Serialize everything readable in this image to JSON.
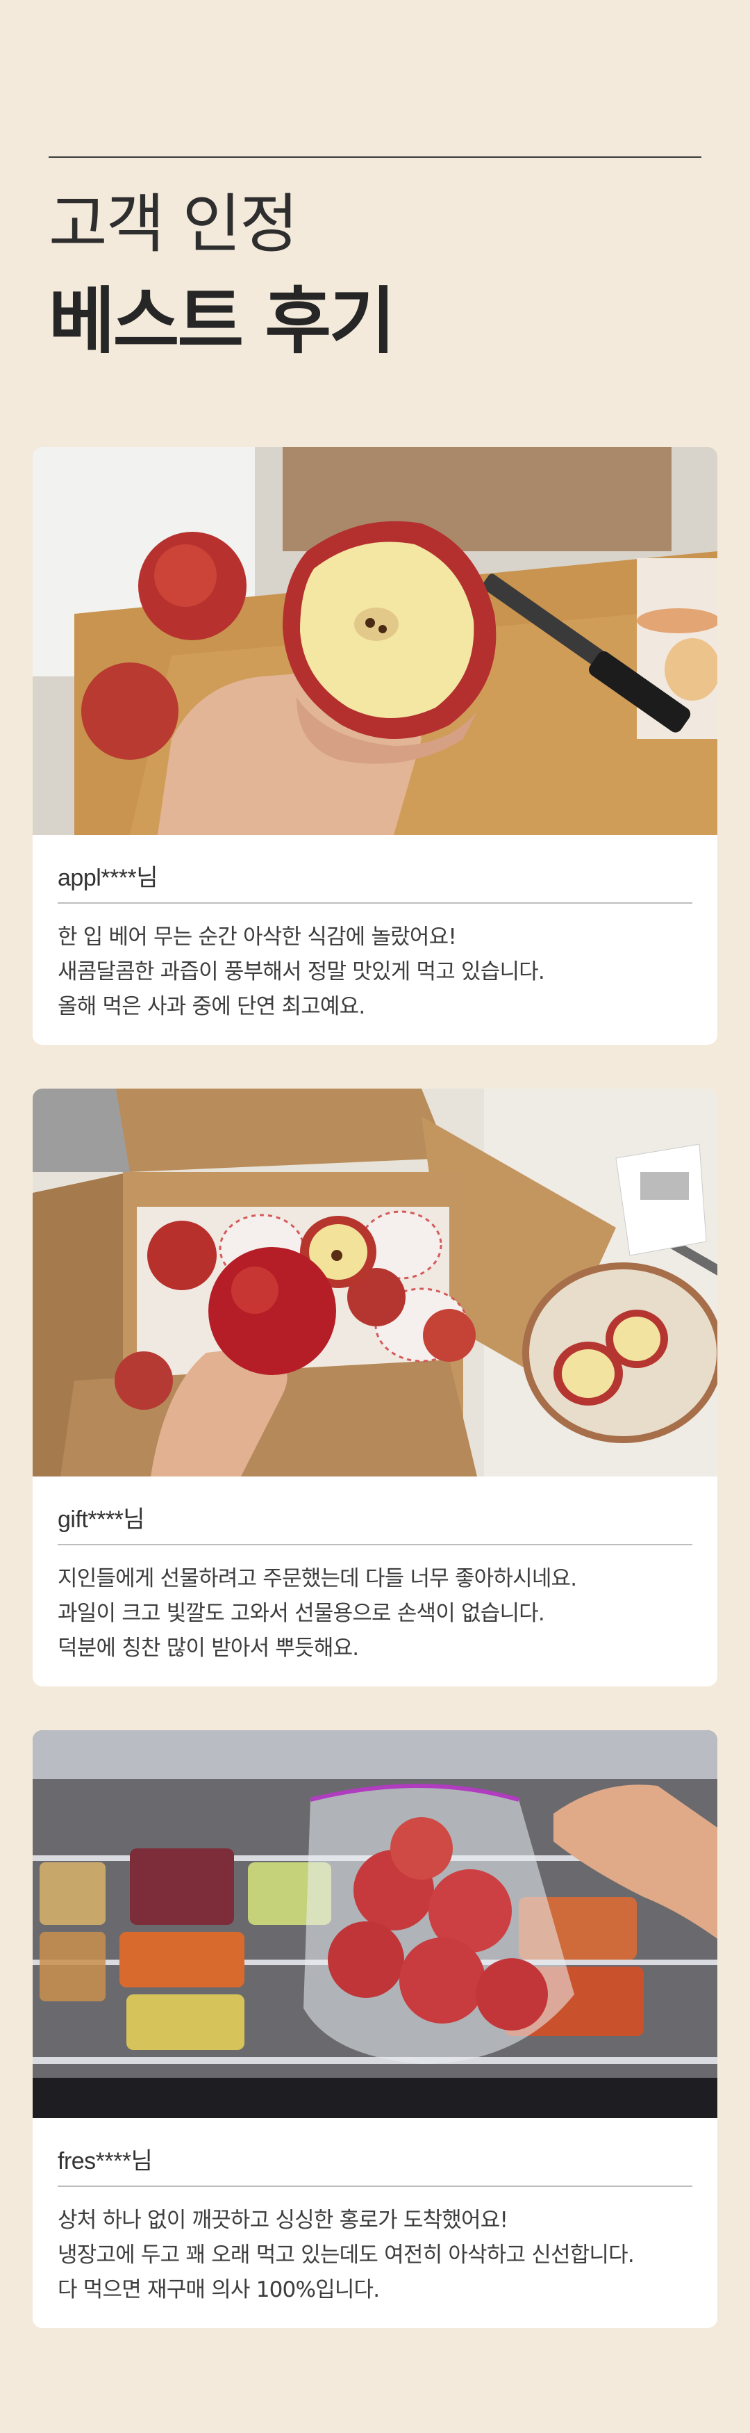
{
  "header": {
    "title_light": "고객 인정",
    "title_bold": "베스트 후기"
  },
  "reviews": [
    {
      "photo_icon": "apple-cut-photo",
      "reviewer": "appl****님",
      "lines": [
        "한 입 베어 무는 순간 아삭한 식감에 놀랐어요!",
        "새콤달콤한 과즙이 풍부해서 정말 맛있게 먹고 있습니다.",
        "올해 먹은 사과 중에 단연 최고예요."
      ]
    },
    {
      "photo_icon": "apple-gift-box-photo",
      "reviewer": "gift****님",
      "lines": [
        "지인들에게 선물하려고 주문했는데 다들 너무 좋아하시네요.",
        "과일이 크고 빛깔도 고와서 선물용으로 손색이 없습니다.",
        "덕분에 칭찬 많이 받아서 뿌듯해요."
      ]
    },
    {
      "photo_icon": "apple-fridge-bag-photo",
      "reviewer": "fres****님",
      "lines": [
        "상처 하나 없이 깨끗하고 싱싱한 홍로가 도착했어요!",
        "냉장고에 두고 꽤 오래 먹고 있는데도 여전히 아삭하고 신선합니다.",
        "다 먹으면 재구매 의사 100%입니다."
      ]
    }
  ]
}
